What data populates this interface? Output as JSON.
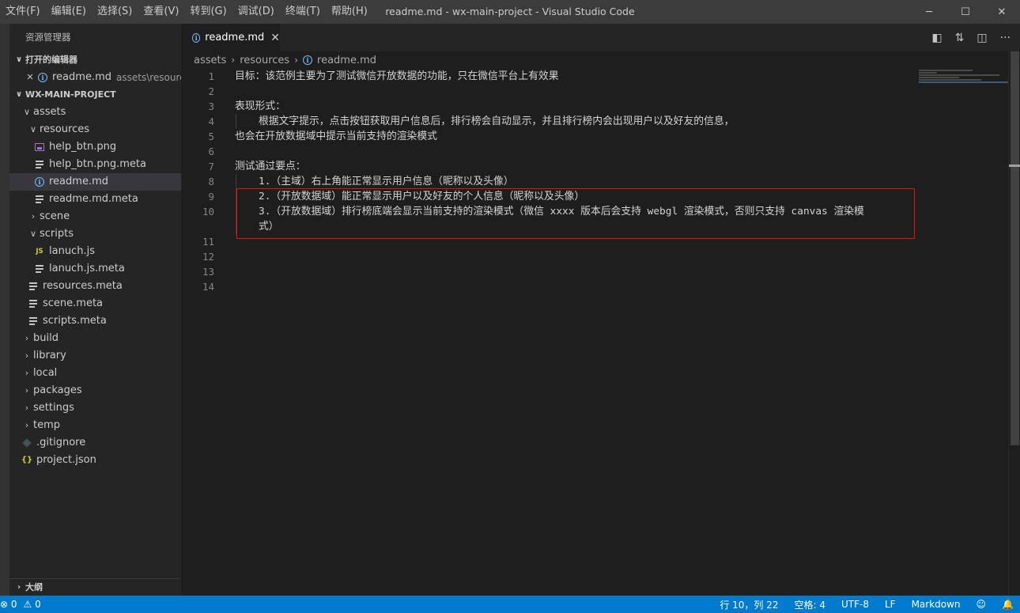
{
  "menu": [
    "文件(F)",
    "编辑(E)",
    "选择(S)",
    "查看(V)",
    "转到(G)",
    "调试(D)",
    "终端(T)",
    "帮助(H)"
  ],
  "window_title": "readme.md - wx-main-project - Visual Studio Code",
  "window_controls": {
    "minimize": "─",
    "maximize": "☐",
    "close": "✕"
  },
  "sidebar": {
    "title": "资源管理器",
    "open_editors_header": "打开的编辑器",
    "open_editors": [
      {
        "name": "readme.md",
        "path": "assets\\resources"
      }
    ],
    "project_header": "WX-MAIN-PROJECT",
    "tree": {
      "assets": "assets",
      "resources": "resources",
      "help_btn_png": "help_btn.png",
      "help_btn_meta": "help_btn.png.meta",
      "readme_md": "readme.md",
      "readme_meta": "readme.md.meta",
      "scene": "scene",
      "scripts": "scripts",
      "lanuch_js": "lanuch.js",
      "lanuch_meta": "lanuch.js.meta",
      "resources_meta": "resources.meta",
      "scene_meta": "scene.meta",
      "scripts_meta": "scripts.meta",
      "build": "build",
      "library": "library",
      "local": "local",
      "packages": "packages",
      "settings": "settings",
      "temp": "temp",
      "gitignore": ".gitignore",
      "project_json": "project.json"
    },
    "outline_header": "大纲"
  },
  "tab": {
    "label": "readme.md",
    "close": "✕"
  },
  "breadcrumb": [
    "assets",
    "resources",
    "readme.md"
  ],
  "editor": {
    "line_numbers": [
      "1",
      "2",
      "3",
      "4",
      "5",
      "6",
      "7",
      "8",
      "9",
      "10",
      "",
      "11",
      "12",
      "13",
      "14"
    ],
    "lines": [
      "目标：该范例主要为了测试微信开放数据的功能，只在微信平台上有效果",
      "",
      "表现形式：",
      "根据文字提示，点击按钮获取用户信息后，排行榜会自动显示，并且排行榜内会出现用户以及好友的信息，",
      "也会在开放数据域中提示当前支持的渲染模式",
      "",
      "测试通过要点：",
      "1.（主域）右上角能正常显示用户信息（昵称以及头像）",
      "2.（开放数据域）能正常显示用户以及好友的个人信息（昵称以及头像）",
      "3.（开放数据域）排行榜底端会显示当前支持的渲染模式（微信 xxxx 版本后会支持 webgl 渲染模式，否则只支持 canvas 渲染模",
      "式）",
      "",
      "",
      "",
      ""
    ]
  },
  "statusbar": {
    "errors": "⊗ 0",
    "warnings": "⚠ 0",
    "position": "行 10，列 22",
    "spaces": "空格: 4",
    "encoding": "UTF-8",
    "eol": "LF",
    "language": "Markdown",
    "feedback": "☺",
    "bell": "🔔"
  },
  "colors": {
    "accent": "#007acc",
    "highlight_box": "#e51400",
    "info_icon": "#75beff"
  }
}
